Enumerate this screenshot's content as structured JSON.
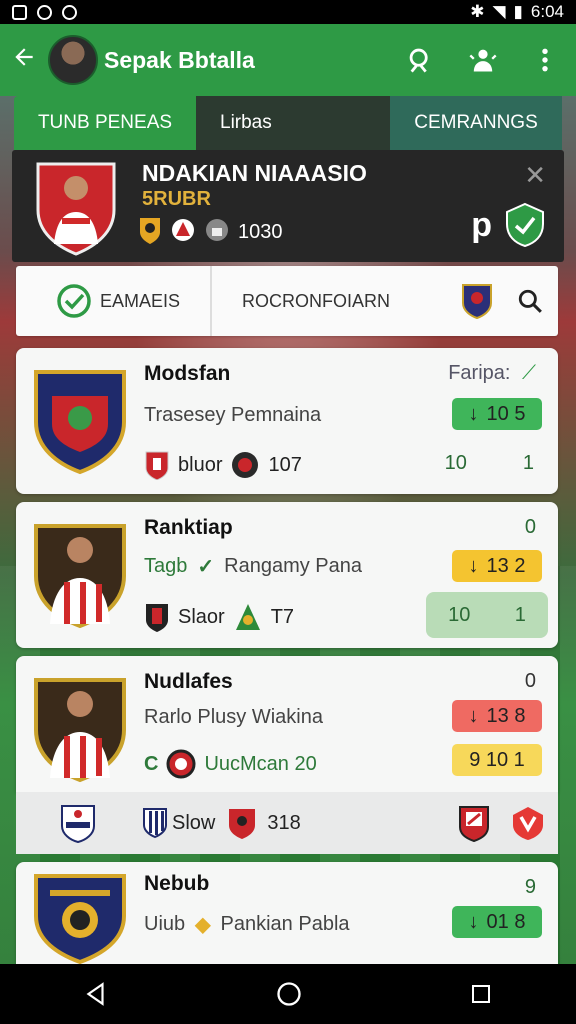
{
  "status_bar": {
    "time": "6:04"
  },
  "app_bar": {
    "title": "Sepak Bbtalla"
  },
  "tabs": [
    {
      "label": "TUNB PENEAS"
    },
    {
      "label": "Lirbas"
    },
    {
      "label": "CEMRANNGS"
    }
  ],
  "hero": {
    "title": "NDAKIAN NIAAASIO",
    "subtitle": "5RUBR",
    "count": "1030",
    "p_label": "p"
  },
  "filters": {
    "left_label": "EAMAEIS",
    "middle_label": "ROCRONFOIARN"
  },
  "cards": [
    {
      "name": "Modsfan",
      "line2": "Trasesey Pemnaina",
      "line3_text": "bluor",
      "line3_num": "107",
      "corner": "Faripa:",
      "pill": "10 5",
      "scores": [
        "10",
        "1"
      ]
    },
    {
      "name": "Ranktiap",
      "line2a": "Tagb",
      "line2b": "Rangamy Pana",
      "line3_text": "Slaor",
      "line3_num": "T7",
      "corner": "0",
      "pill": "13 2",
      "scores": [
        "10",
        "1"
      ]
    },
    {
      "name": "Nudlafes",
      "line2": "Rarlo Plusy Wiakina",
      "line3_text": "UucMcan 20",
      "corner": "0",
      "pill": "13 8",
      "pill2": "9 10 1"
    },
    {
      "name": "Nebub",
      "line2a": "Uiub",
      "line2b": "Pankian Pabla",
      "corner": "9",
      "pill": "01 8"
    }
  ],
  "subrow": {
    "text": "Slow",
    "num": "318"
  },
  "colors": {
    "accent": "#2e9a45",
    "dark": "#262626",
    "gold": "#e2b23c"
  }
}
